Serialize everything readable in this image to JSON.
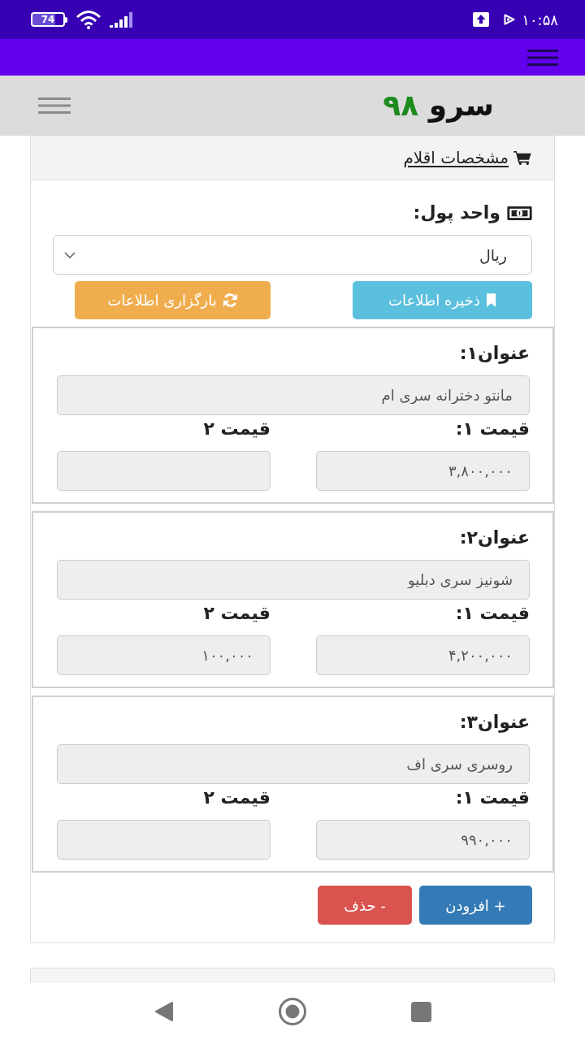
{
  "status_bar": {
    "battery": "74",
    "time": "۱۰:۵۸"
  },
  "header": {
    "brand_name": "سرو",
    "brand_number": "۹۸"
  },
  "card": {
    "title": "مشخصات اقلام",
    "currency": {
      "label": "واحد پول:",
      "value": "ریال"
    },
    "buttons": [
      {
        "label": "ذخیره اطلاعات",
        "kind": "save"
      },
      {
        "label": "بارگزاری اطلاعات",
        "kind": "reload"
      }
    ],
    "items": [
      {
        "title": {
          "label": "عنوان۱:",
          "value": "مانتو دخترانه سری ام"
        },
        "prices": [
          {
            "label": "قیمت ۱:",
            "value": "۳,۸۰۰,۰۰۰"
          },
          {
            "label": "قیمت ۲"
          }
        ]
      },
      {
        "title": {
          "label": "عنوان۲:",
          "value": "شونیز سری دبلیو"
        },
        "prices": [
          {
            "label": "قیمت ۱:",
            "value": "۴,۲۰۰,۰۰۰"
          },
          {
            "label": "قیمت ۲",
            "value": "۱۰۰,۰۰۰"
          }
        ]
      },
      {
        "title": {
          "label": "عنوان۳:",
          "value": "روسری سری اف"
        },
        "prices": [
          {
            "label": "قیمت ۱:",
            "value": "۹۹۰,۰۰۰"
          },
          {
            "label": "قیمت ۲"
          }
        ]
      }
    ],
    "actions": [
      {
        "label": "+ افزودن",
        "kind": "add"
      },
      {
        "label": "- حذف",
        "kind": "delete"
      }
    ]
  }
}
